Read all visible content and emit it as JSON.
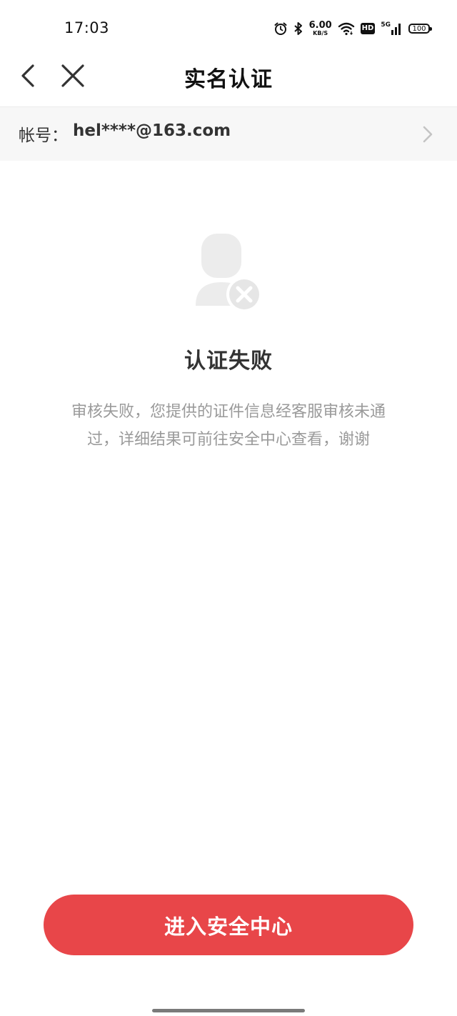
{
  "status_bar": {
    "time": "17:03",
    "net_speed_value": "6.00",
    "net_speed_unit": "KB/S",
    "hd_label": "HD",
    "network_label": "5G",
    "battery_level": "100",
    "icons": [
      "alarm-icon",
      "bluetooth-icon",
      "wifi-icon",
      "signal-icon",
      "battery-icon"
    ]
  },
  "header": {
    "title": "实名认证",
    "back_icon": "chevron-left-icon",
    "close_icon": "close-icon"
  },
  "account": {
    "label": "帐号：",
    "value": "hel****@163.com",
    "chevron_icon": "chevron-right-icon"
  },
  "result": {
    "icon": "user-failed-icon",
    "title": "认证失败",
    "description_line1": "审核失败，您提供的证件信息经客服审核未通",
    "description_line2": "过，详细结果可前往安全中心查看，谢谢"
  },
  "action": {
    "button_label": "进入安全中心"
  },
  "colors": {
    "accent": "#e84649",
    "muted_text": "#9a9a9a",
    "row_background": "#f7f7f7"
  }
}
